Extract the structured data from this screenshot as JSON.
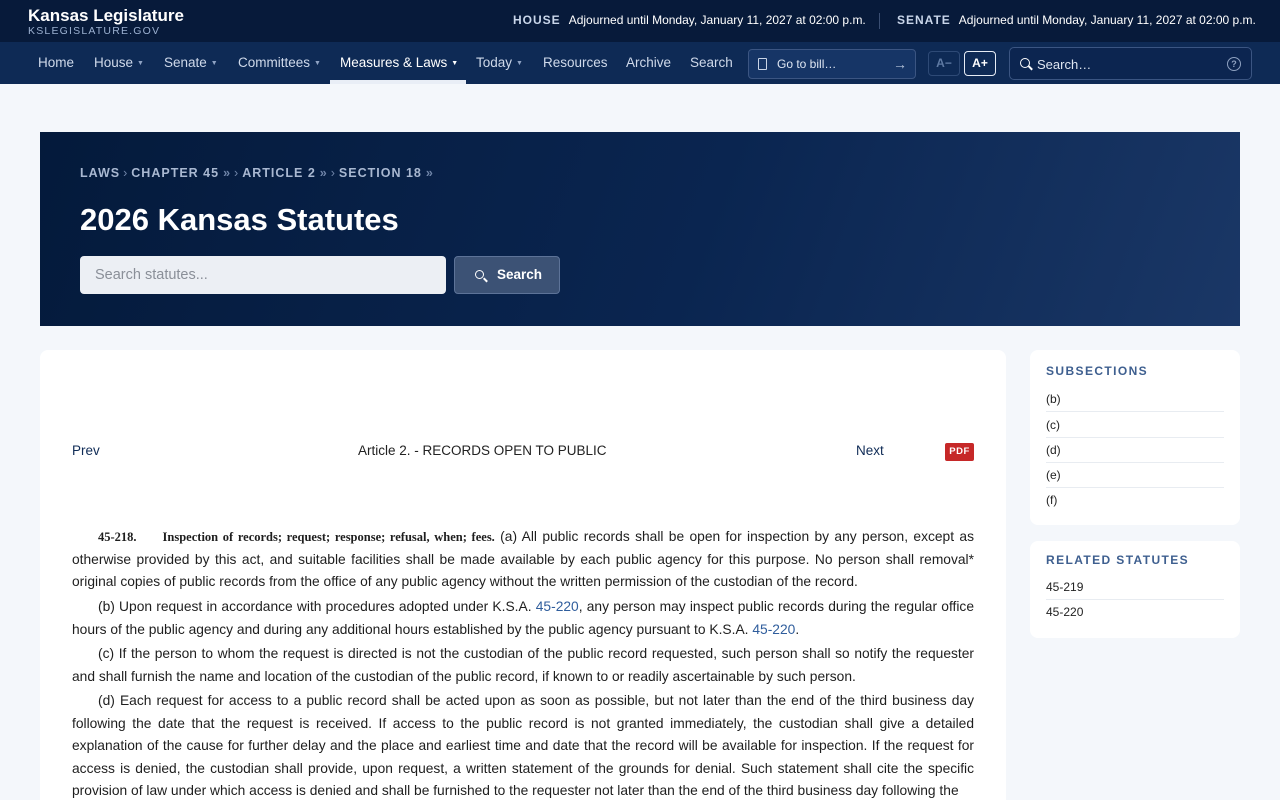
{
  "header": {
    "site_title": "Kansas Legislature",
    "site_url": "KSLEGISLATURE.GOV",
    "house_label": "HOUSE",
    "house_status": "Adjourned until Monday, January 11, 2027 at 02:00 p.m.",
    "senate_label": "SENATE",
    "senate_status": "Adjourned until Monday, January 11, 2027 at 02:00 p.m."
  },
  "nav": {
    "items": [
      {
        "label": "Home"
      },
      {
        "label": "House"
      },
      {
        "label": "Senate"
      },
      {
        "label": "Committees"
      },
      {
        "label": "Measures & Laws"
      },
      {
        "label": "Today"
      },
      {
        "label": "Resources"
      },
      {
        "label": "Archive"
      },
      {
        "label": "Search"
      }
    ],
    "goto_bill_placeholder": "Go to bill…",
    "font_decrease_label": "A−",
    "font_increase_label": "A+",
    "site_search_placeholder": "Search…",
    "help_label": "?"
  },
  "hero": {
    "breadcrumb": [
      "LAWS",
      "CHAPTER 45",
      "ARTICLE 2",
      "SECTION 18"
    ],
    "title": "2026 Kansas Statutes",
    "search_placeholder": "Search statutes...",
    "search_button": "Search"
  },
  "content": {
    "prev_label": "Prev",
    "article_title": "Article 2. - RECORDS OPEN TO PUBLIC",
    "next_label": "Next",
    "pdf_label": "PDF",
    "section_number": "45-218.",
    "section_heading": "Inspection of records; request; response; refusal, when; fees.",
    "p1_text": "(a) All public records shall be open for inspection by any person, except as otherwise provided by this act, and suitable facilities shall be made available by each public agency for this purpose. No person shall removal* original copies of public records from the office of any public agency without the written permission of the custodian of the record.",
    "p2_a": "(b)   Upon request in accordance with procedures adopted under K.S.A.",
    "p2_link1": "45-220",
    "p2_b": ", any person may inspect public records during the regular office hours of the public agency and during any additional hours established by the public agency pursuant to K.S.A.",
    "p2_link2": "45-220",
    "p2_c": ".",
    "p3_text": "(c)   If the person to whom the request is directed is not the custodian of the public record requested, such person shall so notify the requester and shall furnish the name and location of the custodian of the public record, if known to or readily ascertainable by such person.",
    "p4_text": "(d)   Each request for access to a public record shall be acted upon as soon as possible, but not later than the end of the third business day following the date that the request is received. If access to the public record is not granted immediately, the custodian shall give a detailed explanation of the cause for further delay and the place and earliest time and date that the record will be available for inspection. If the request for access is denied, the custodian shall provide, upon request, a written statement of the grounds for denial. Such statement shall cite the specific provision of law under which access is denied and shall be furnished to the requester not later than the end of the third business day following the"
  },
  "sidebar": {
    "subsections_title": "SUBSECTIONS",
    "subsections": [
      "(b)",
      "(c)",
      "(d)",
      "(e)",
      "(f)"
    ],
    "related_title": "RELATED STATUTES",
    "related": [
      "45-219",
      "45-220"
    ]
  }
}
